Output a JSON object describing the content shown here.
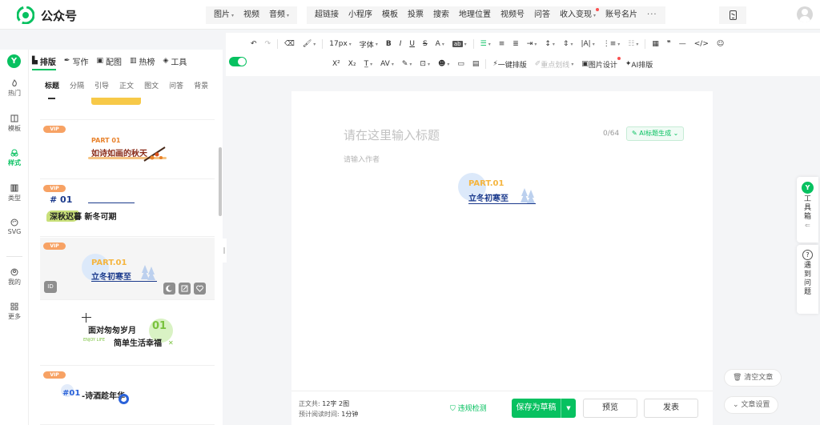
{
  "app": {
    "title": "公众号"
  },
  "topnav": {
    "group1": [
      {
        "label": "图片",
        "dropdown": true
      },
      {
        "label": "视频",
        "dropdown": false
      },
      {
        "label": "音频",
        "dropdown": true
      }
    ],
    "group2": [
      {
        "label": "超链接"
      },
      {
        "label": "小程序"
      },
      {
        "label": "模板"
      },
      {
        "label": "投票"
      },
      {
        "label": "搜索"
      },
      {
        "label": "地理位置"
      },
      {
        "label": "视频号"
      },
      {
        "label": "问答"
      },
      {
        "label": "收入变现",
        "dropdown": true,
        "reddot": true
      },
      {
        "label": "账号名片"
      },
      {
        "label": "···"
      }
    ]
  },
  "rail": {
    "items": [
      {
        "label": "热门"
      },
      {
        "label": "模板"
      },
      {
        "label": "样式",
        "active": true
      },
      {
        "label": "类型"
      },
      {
        "label": "SVG"
      },
      {
        "label": "我的"
      },
      {
        "label": "更多"
      }
    ],
    "badge": "Y"
  },
  "panel": {
    "tabs": [
      {
        "label": "排版",
        "active": true
      },
      {
        "label": "写作"
      },
      {
        "label": "配图"
      },
      {
        "label": "热榜"
      },
      {
        "label": "工具"
      }
    ],
    "subtabs": [
      {
        "label": "标题",
        "active": true
      },
      {
        "label": "分隔"
      },
      {
        "label": "引导"
      },
      {
        "label": "正文"
      },
      {
        "label": "图文"
      },
      {
        "label": "问答"
      },
      {
        "label": "背景"
      }
    ],
    "vip_label": "VIP",
    "id_chip": "ID",
    "cards": {
      "c2": {
        "part": "PART 01",
        "text": "如诗如画的秋天"
      },
      "c3": {
        "num": "# 01",
        "text": "深秋迟暮 新冬可期"
      },
      "c4": {
        "part": "PART.01",
        "text": "立冬初寒至"
      },
      "c5": {
        "line1": "面对匆匆岁月",
        "num": "01",
        "small": "ENJOY LIFE",
        "line2": "简单生活幸福"
      },
      "c6": {
        "num": "#01",
        "text": "-诗酒趁年华"
      }
    }
  },
  "toolbar": {
    "font_size": "17px",
    "font_family": "字体",
    "row2_a": [
      "X²",
      "X₂"
    ],
    "one_click": "一键排版",
    "highlight": "重点划线",
    "image_design": "图片设计",
    "ai_layout": "AI排版"
  },
  "editor": {
    "title_placeholder": "请在这里输入标题",
    "title_count": "0/64",
    "ai_title": "AI标题生成",
    "author_placeholder": "请输入作者",
    "inserted": {
      "part": "PART.01",
      "text": "立冬初寒至"
    }
  },
  "status": {
    "word_label": "正文共:",
    "word_count": "12字",
    "image_count": "2图",
    "read_label": "预计阅读时间:",
    "read_time": "1分钟",
    "check": "违规检测",
    "save": "保存为草稿",
    "preview": "预览",
    "publish": "发表"
  },
  "right": {
    "toolbox_badge": "Y",
    "toolbox": "工具箱",
    "help": "遇到问题",
    "clear": "清空文章",
    "settings": "文章设置"
  },
  "colors": {
    "accent": "#07c160",
    "vip": "#f7a264",
    "navy": "#1b3a8c",
    "gold": "#f5b53f"
  }
}
